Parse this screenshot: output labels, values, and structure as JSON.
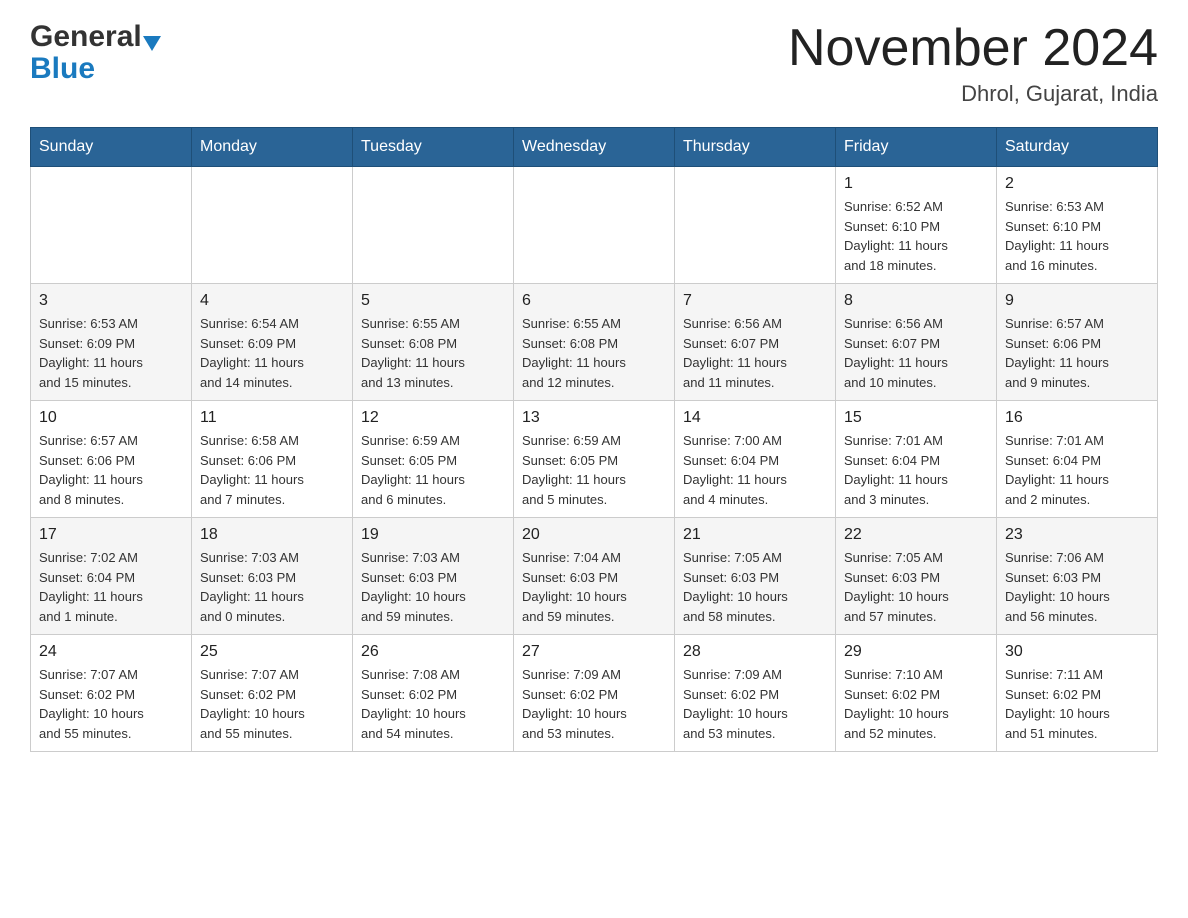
{
  "header": {
    "logo_general": "General",
    "logo_blue": "Blue",
    "title": "November 2024",
    "subtitle": "Dhrol, Gujarat, India"
  },
  "weekdays": [
    "Sunday",
    "Monday",
    "Tuesday",
    "Wednesday",
    "Thursday",
    "Friday",
    "Saturday"
  ],
  "weeks": [
    {
      "days": [
        {
          "num": "",
          "info": ""
        },
        {
          "num": "",
          "info": ""
        },
        {
          "num": "",
          "info": ""
        },
        {
          "num": "",
          "info": ""
        },
        {
          "num": "",
          "info": ""
        },
        {
          "num": "1",
          "info": "Sunrise: 6:52 AM\nSunset: 6:10 PM\nDaylight: 11 hours\nand 18 minutes."
        },
        {
          "num": "2",
          "info": "Sunrise: 6:53 AM\nSunset: 6:10 PM\nDaylight: 11 hours\nand 16 minutes."
        }
      ]
    },
    {
      "days": [
        {
          "num": "3",
          "info": "Sunrise: 6:53 AM\nSunset: 6:09 PM\nDaylight: 11 hours\nand 15 minutes."
        },
        {
          "num": "4",
          "info": "Sunrise: 6:54 AM\nSunset: 6:09 PM\nDaylight: 11 hours\nand 14 minutes."
        },
        {
          "num": "5",
          "info": "Sunrise: 6:55 AM\nSunset: 6:08 PM\nDaylight: 11 hours\nand 13 minutes."
        },
        {
          "num": "6",
          "info": "Sunrise: 6:55 AM\nSunset: 6:08 PM\nDaylight: 11 hours\nand 12 minutes."
        },
        {
          "num": "7",
          "info": "Sunrise: 6:56 AM\nSunset: 6:07 PM\nDaylight: 11 hours\nand 11 minutes."
        },
        {
          "num": "8",
          "info": "Sunrise: 6:56 AM\nSunset: 6:07 PM\nDaylight: 11 hours\nand 10 minutes."
        },
        {
          "num": "9",
          "info": "Sunrise: 6:57 AM\nSunset: 6:06 PM\nDaylight: 11 hours\nand 9 minutes."
        }
      ]
    },
    {
      "days": [
        {
          "num": "10",
          "info": "Sunrise: 6:57 AM\nSunset: 6:06 PM\nDaylight: 11 hours\nand 8 minutes."
        },
        {
          "num": "11",
          "info": "Sunrise: 6:58 AM\nSunset: 6:06 PM\nDaylight: 11 hours\nand 7 minutes."
        },
        {
          "num": "12",
          "info": "Sunrise: 6:59 AM\nSunset: 6:05 PM\nDaylight: 11 hours\nand 6 minutes."
        },
        {
          "num": "13",
          "info": "Sunrise: 6:59 AM\nSunset: 6:05 PM\nDaylight: 11 hours\nand 5 minutes."
        },
        {
          "num": "14",
          "info": "Sunrise: 7:00 AM\nSunset: 6:04 PM\nDaylight: 11 hours\nand 4 minutes."
        },
        {
          "num": "15",
          "info": "Sunrise: 7:01 AM\nSunset: 6:04 PM\nDaylight: 11 hours\nand 3 minutes."
        },
        {
          "num": "16",
          "info": "Sunrise: 7:01 AM\nSunset: 6:04 PM\nDaylight: 11 hours\nand 2 minutes."
        }
      ]
    },
    {
      "days": [
        {
          "num": "17",
          "info": "Sunrise: 7:02 AM\nSunset: 6:04 PM\nDaylight: 11 hours\nand 1 minute."
        },
        {
          "num": "18",
          "info": "Sunrise: 7:03 AM\nSunset: 6:03 PM\nDaylight: 11 hours\nand 0 minutes."
        },
        {
          "num": "19",
          "info": "Sunrise: 7:03 AM\nSunset: 6:03 PM\nDaylight: 10 hours\nand 59 minutes."
        },
        {
          "num": "20",
          "info": "Sunrise: 7:04 AM\nSunset: 6:03 PM\nDaylight: 10 hours\nand 59 minutes."
        },
        {
          "num": "21",
          "info": "Sunrise: 7:05 AM\nSunset: 6:03 PM\nDaylight: 10 hours\nand 58 minutes."
        },
        {
          "num": "22",
          "info": "Sunrise: 7:05 AM\nSunset: 6:03 PM\nDaylight: 10 hours\nand 57 minutes."
        },
        {
          "num": "23",
          "info": "Sunrise: 7:06 AM\nSunset: 6:03 PM\nDaylight: 10 hours\nand 56 minutes."
        }
      ]
    },
    {
      "days": [
        {
          "num": "24",
          "info": "Sunrise: 7:07 AM\nSunset: 6:02 PM\nDaylight: 10 hours\nand 55 minutes."
        },
        {
          "num": "25",
          "info": "Sunrise: 7:07 AM\nSunset: 6:02 PM\nDaylight: 10 hours\nand 55 minutes."
        },
        {
          "num": "26",
          "info": "Sunrise: 7:08 AM\nSunset: 6:02 PM\nDaylight: 10 hours\nand 54 minutes."
        },
        {
          "num": "27",
          "info": "Sunrise: 7:09 AM\nSunset: 6:02 PM\nDaylight: 10 hours\nand 53 minutes."
        },
        {
          "num": "28",
          "info": "Sunrise: 7:09 AM\nSunset: 6:02 PM\nDaylight: 10 hours\nand 53 minutes."
        },
        {
          "num": "29",
          "info": "Sunrise: 7:10 AM\nSunset: 6:02 PM\nDaylight: 10 hours\nand 52 minutes."
        },
        {
          "num": "30",
          "info": "Sunrise: 7:11 AM\nSunset: 6:02 PM\nDaylight: 10 hours\nand 51 minutes."
        }
      ]
    }
  ]
}
